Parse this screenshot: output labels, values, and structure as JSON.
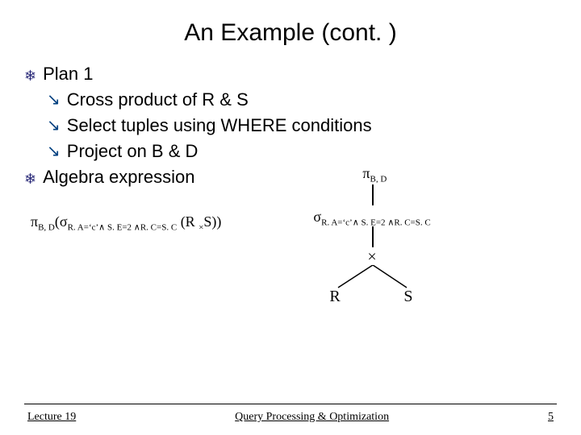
{
  "title": "An Example (cont. )",
  "bullets": {
    "plan": "Plan 1",
    "cross": "Cross product of R & S",
    "select": "Select tuples using WHERE conditions",
    "project": "Project on B & D",
    "algebra": "Algebra expression"
  },
  "formula": {
    "pi": "π",
    "pi_sub": "B, D",
    "open": "(",
    "sigma": "σ",
    "cond_a": "R. A=‘c’",
    "and": "∧",
    "cond_b": " S. E=2 ",
    "cond_c": "R. C=S. C",
    "close_inner": " (R ",
    "cross_op": "×",
    "close_outer": "S))"
  },
  "tree": {
    "pi": "π",
    "pi_sub": "B, D",
    "sigma": "σ",
    "cond_a": "R. A=‘c’",
    "and": "∧",
    "cond_b": " S. E=2 ",
    "cond_c": "R. C=S. C",
    "cross": "×",
    "R": "R",
    "S": "S"
  },
  "footer": {
    "left": "Lecture 19",
    "center": "Query Processing & Optimization",
    "right": "5"
  }
}
